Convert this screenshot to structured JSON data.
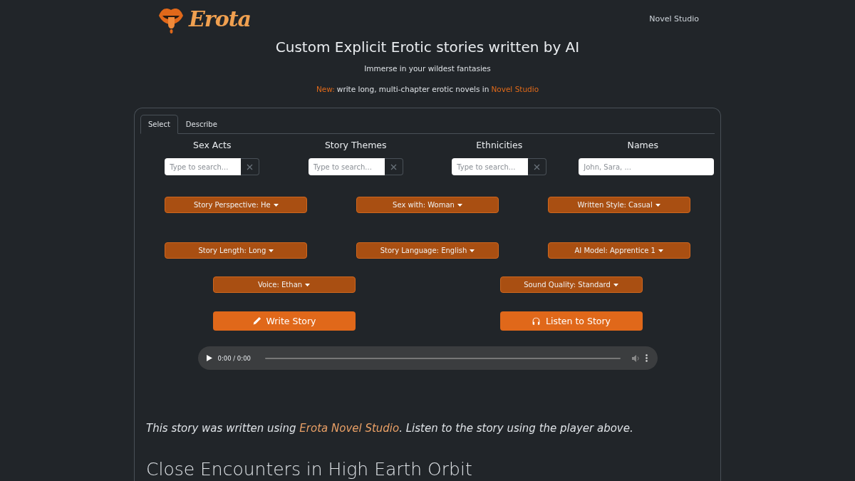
{
  "header": {
    "logo_text": "Erota",
    "nav_link": "Novel Studio"
  },
  "hero": {
    "title": "Custom Explicit Erotic stories written by AI",
    "subtitle": "Immerse in your wildest fantasies",
    "announcement": {
      "label": "New:",
      "text": "write long, multi-chapter erotic novels in",
      "link": "Novel Studio"
    }
  },
  "tabs": [
    {
      "label": "Select",
      "selected": true
    },
    {
      "label": "Describe",
      "selected": false
    }
  ],
  "filters": [
    {
      "title": "Sex Acts",
      "kind": "search",
      "placeholder": "Type to search..."
    },
    {
      "title": "Story Themes",
      "kind": "search",
      "placeholder": "Type to search..."
    },
    {
      "title": "Ethnicities",
      "kind": "search",
      "placeholder": "Type to search..."
    },
    {
      "title": "Names",
      "kind": "text",
      "placeholder": "John, Sara, ..."
    }
  ],
  "dropdown_rows": [
    [
      "Story Perspective: He",
      "Sex with: Woman",
      "Written Style: Casual"
    ],
    [
      "Story Length: Long",
      "Story Language: English",
      "AI Model: Apprentice 1"
    ],
    [
      "Voice: Ethan",
      "Sound Quality: Standard"
    ]
  ],
  "actions": [
    {
      "label": "Write Story",
      "kind": "write"
    },
    {
      "label": "Listen to Story",
      "kind": "listen"
    }
  ],
  "player": {
    "time": "0:00 / 0:00"
  },
  "note": {
    "before": "This story was written using",
    "link": "Erota Novel Studio",
    "after": ". Listen to the story using the player above."
  },
  "story_title": "Close Encounters in High Earth Orbit"
}
